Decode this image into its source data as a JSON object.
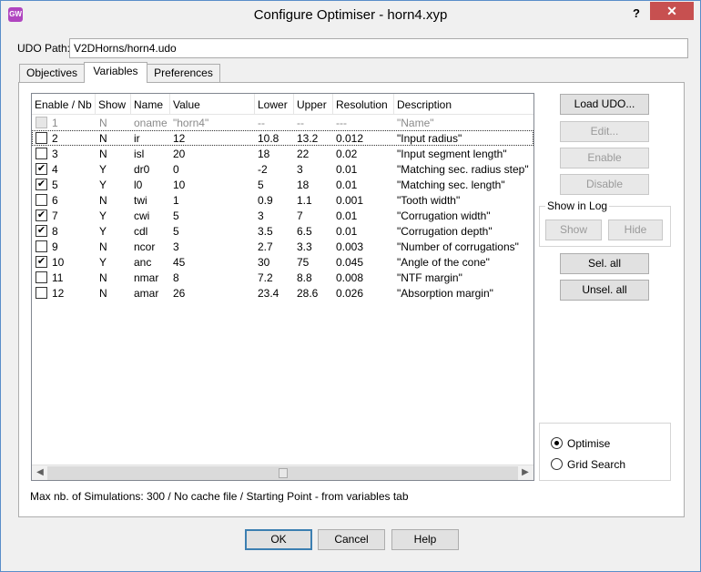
{
  "window": {
    "title": "Configure Optimiser - horn4.xyp",
    "icon_text": "GW",
    "help_label": "?",
    "close_label": "✕"
  },
  "udo": {
    "label": "UDO Path:",
    "value": "V2DHorns/horn4.udo"
  },
  "tabs": [
    {
      "label": "Objectives",
      "active": false
    },
    {
      "label": "Variables",
      "active": true
    },
    {
      "label": "Preferences",
      "active": false
    }
  ],
  "table": {
    "columns": [
      "Enable / Nb",
      "Show",
      "Name",
      "Value",
      "Lower",
      "Upper",
      "Resolution",
      "Description"
    ],
    "rows": [
      {
        "checked": false,
        "disabled": true,
        "nb": "1",
        "show": "N",
        "name": "oname",
        "value": "\"horn4\"",
        "lower": "--",
        "upper": "--",
        "resolution": "---",
        "description": "\"Name\""
      },
      {
        "checked": false,
        "disabled": false,
        "nb": "2",
        "show": "N",
        "name": "ir",
        "value": "12",
        "lower": "10.8",
        "upper": "13.2",
        "resolution": "0.012",
        "description": "\"Input radius\""
      },
      {
        "checked": false,
        "disabled": false,
        "nb": "3",
        "show": "N",
        "name": "isl",
        "value": "20",
        "lower": "18",
        "upper": "22",
        "resolution": "0.02",
        "description": "\"Input segment length\""
      },
      {
        "checked": true,
        "disabled": false,
        "nb": "4",
        "show": "Y",
        "name": "dr0",
        "value": "0",
        "lower": "-2",
        "upper": "3",
        "resolution": "0.01",
        "description": "\"Matching  sec. radius step\""
      },
      {
        "checked": true,
        "disabled": false,
        "nb": "5",
        "show": "Y",
        "name": "l0",
        "value": "10",
        "lower": "5",
        "upper": "18",
        "resolution": "0.01",
        "description": "\"Matching sec. length\""
      },
      {
        "checked": false,
        "disabled": false,
        "nb": "6",
        "show": "N",
        "name": "twi",
        "value": "1",
        "lower": "0.9",
        "upper": "1.1",
        "resolution": "0.001",
        "description": "\"Tooth  width\""
      },
      {
        "checked": true,
        "disabled": false,
        "nb": "7",
        "show": "Y",
        "name": "cwi",
        "value": "5",
        "lower": "3",
        "upper": "7",
        "resolution": "0.01",
        "description": "\"Corrugation  width\""
      },
      {
        "checked": true,
        "disabled": false,
        "nb": "8",
        "show": "Y",
        "name": "cdl",
        "value": "5",
        "lower": "3.5",
        "upper": "6.5",
        "resolution": "0.01",
        "description": "\"Corrugation depth\""
      },
      {
        "checked": false,
        "disabled": false,
        "nb": "9",
        "show": "N",
        "name": "ncor",
        "value": "3",
        "lower": "2.7",
        "upper": "3.3",
        "resolution": "0.003",
        "description": "\"Number of corrugations\""
      },
      {
        "checked": true,
        "disabled": false,
        "nb": "10",
        "show": "Y",
        "name": "anc",
        "value": "45",
        "lower": "30",
        "upper": "75",
        "resolution": "0.045",
        "description": "\"Angle of the cone\""
      },
      {
        "checked": false,
        "disabled": false,
        "nb": "11",
        "show": "N",
        "name": "nmar",
        "value": "8",
        "lower": "7.2",
        "upper": "8.8",
        "resolution": "0.008",
        "description": "\"NTF margin\""
      },
      {
        "checked": false,
        "disabled": false,
        "nb": "12",
        "show": "N",
        "name": "amar",
        "value": "26",
        "lower": "23.4",
        "upper": "28.6",
        "resolution": "0.026",
        "description": "\"Absorption margin\""
      }
    ]
  },
  "side_buttons": {
    "load": "Load UDO...",
    "edit": "Edit...",
    "enable": "Enable",
    "disable": "Disable",
    "sel_all": "Sel. all",
    "unsel_all": "Unsel. all"
  },
  "show_in_log": {
    "title": "Show in Log",
    "show": "Show",
    "hide": "Hide"
  },
  "mode": {
    "optimise": "Optimise",
    "grid_search": "Grid Search",
    "selected": "optimise"
  },
  "info": "Max nb. of Simulations: 300 / No cache file / Starting Point - from variables tab",
  "footer": {
    "ok": "OK",
    "cancel": "Cancel",
    "help": "Help"
  }
}
